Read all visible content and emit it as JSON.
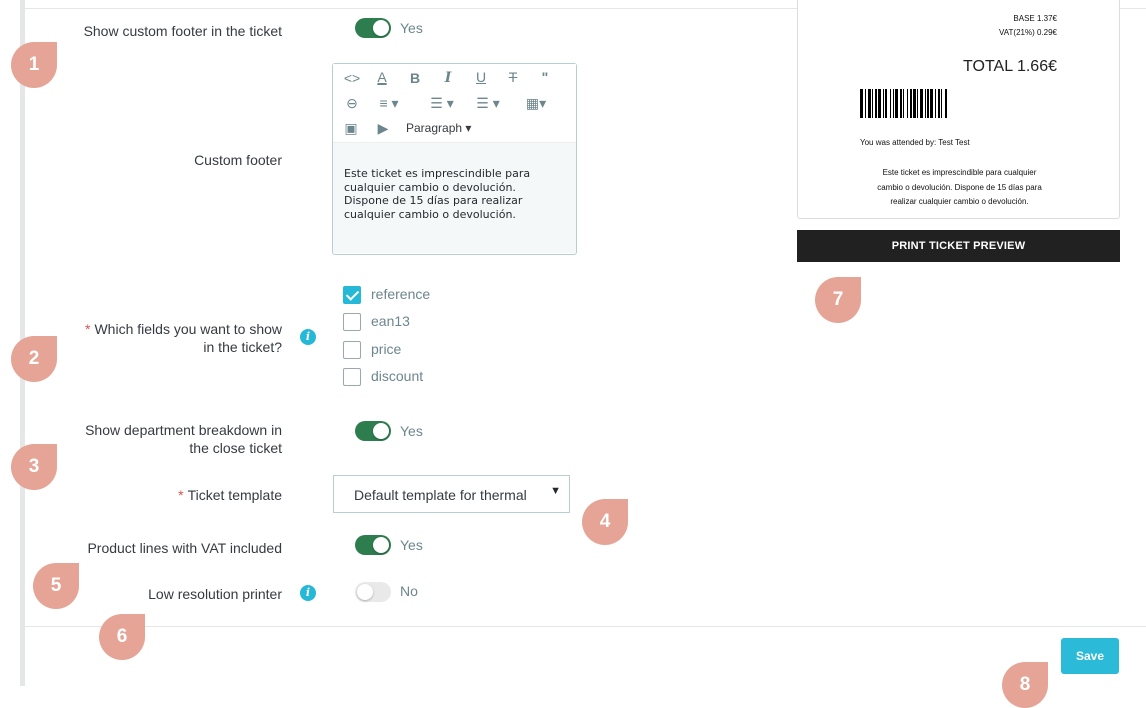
{
  "form": {
    "custom_footer_toggle": {
      "label": "Show custom footer in the ticket",
      "state": "Yes"
    },
    "custom_footer": {
      "label": "Custom footer",
      "toolbar": {
        "paragraph_label": "Paragraph",
        "icons": [
          "code-icon",
          "font-color-icon",
          "bold-icon",
          "italic-icon",
          "underline-icon",
          "strikethrough-icon",
          "blockquote-icon",
          "link-icon",
          "align-icon",
          "bullet-list-icon",
          "numbered-list-icon",
          "table-icon",
          "image-icon",
          "media-icon"
        ]
      },
      "content_lines": [
        "Este ticket es imprescindible para",
        "cualquier cambio o devolución.",
        "Dispone de 15 días para realizar",
        "cualquier cambio o devolución."
      ]
    },
    "fields": {
      "label_line1": "Which fields you want to show",
      "label_line2": "in the ticket?",
      "required_mark": "*",
      "options": [
        {
          "label": "reference",
          "checked": true
        },
        {
          "label": "ean13",
          "checked": false
        },
        {
          "label": "price",
          "checked": false
        },
        {
          "label": "discount",
          "checked": false
        }
      ]
    },
    "department_toggle": {
      "label_line1": "Show department breakdown in",
      "label_line2": "the close ticket",
      "state": "Yes"
    },
    "ticket_template": {
      "label": "Ticket template",
      "required_mark": "*",
      "value": "Default template for thermal"
    },
    "vat_toggle": {
      "label": "Product lines with VAT included",
      "state": "Yes"
    },
    "low_res_toggle": {
      "label": "Low resolution printer",
      "state": "No"
    }
  },
  "preview": {
    "base": "BASE 1.37€",
    "vat": "VAT(21%) 0.29€",
    "total": "TOTAL 1.66€",
    "attended": "You was attended by: Test Test",
    "footer_lines": [
      "Este ticket es imprescindible para cualquier",
      "cambio o devolución. Dispone de 15 días para",
      "realizar cualquier cambio o devolución."
    ],
    "print_button": "PRINT TICKET PREVIEW"
  },
  "save_button": "Save",
  "badges": [
    "1",
    "2",
    "3",
    "4",
    "5",
    "6",
    "7",
    "8"
  ],
  "colors": {
    "toggle_on": "#2e7d4f",
    "accent": "#25b9d7",
    "badge": "#e5a495",
    "required": "#d9534f"
  }
}
